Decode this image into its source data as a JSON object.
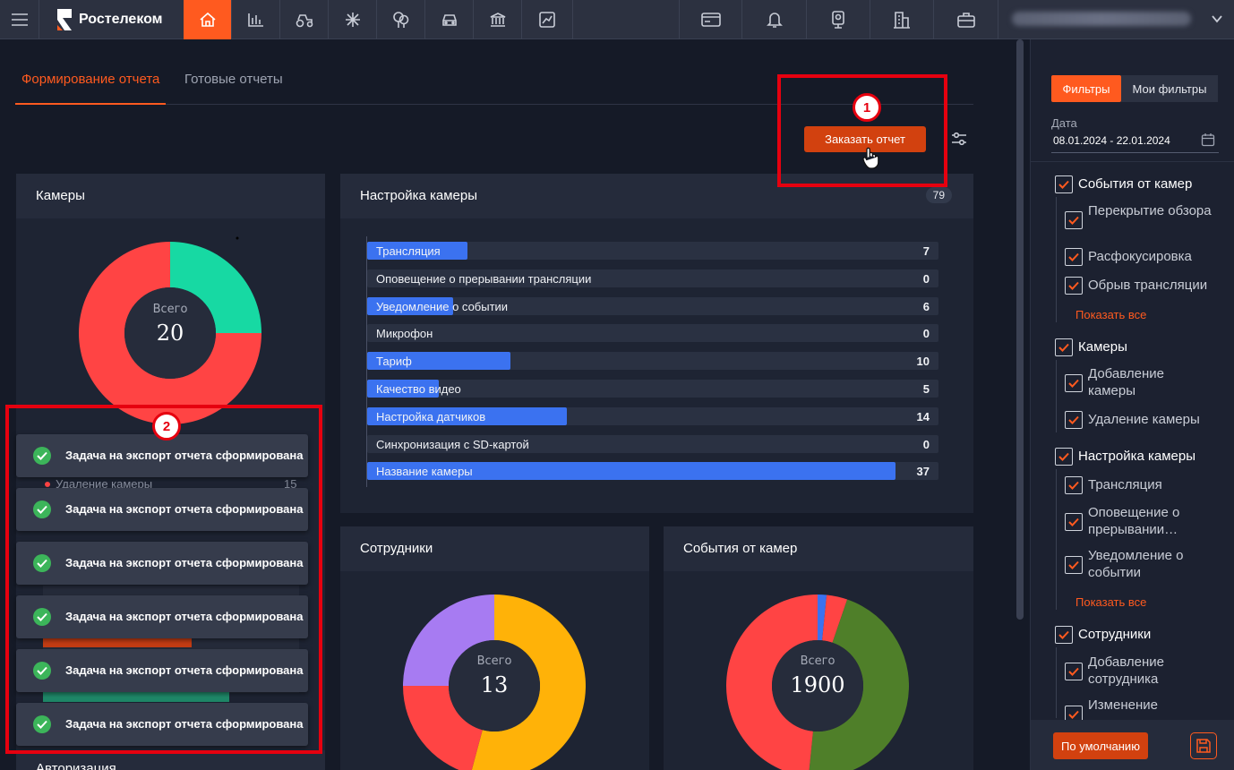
{
  "brand": {
    "name": "Ростелеком"
  },
  "user": {
    "email": ""
  },
  "tabs": [
    {
      "label": "Формирование отчета",
      "active": true
    },
    {
      "label": "Готовые отчеты",
      "active": false
    }
  ],
  "toolbar": {
    "order_report_label": "Заказать отчет"
  },
  "cameras_card": {
    "title": "Камеры",
    "total_label": "Всего",
    "total_value": "20",
    "legend_partial": "Удаление камеры",
    "legend_partial_value": "15",
    "bottom_title": "Авторизация"
  },
  "camera_settings_card": {
    "title": "Настройка камеры",
    "count": "79",
    "rows": [
      {
        "label": "Трансляция",
        "value": "7"
      },
      {
        "label": "Оповещение о прерывании трансляции",
        "value": "0"
      },
      {
        "label": "Уведомление о событии",
        "value": "6"
      },
      {
        "label": "Микрофон",
        "value": "0"
      },
      {
        "label": "Тариф",
        "value": "10"
      },
      {
        "label": "Качество видео",
        "value": "5"
      },
      {
        "label": "Настройка датчиков",
        "value": "14"
      },
      {
        "label": "Синхронизация с SD-картой",
        "value": "0"
      },
      {
        "label": "Название камеры",
        "value": "37"
      }
    ]
  },
  "employees_card": {
    "title": "Сотрудники",
    "total_label": "Всего",
    "total_value": "13"
  },
  "events_card": {
    "title": "События от камер",
    "total_label": "Всего",
    "total_value": "1900"
  },
  "notifications": [
    "Задача на экспорт отчета сформирована",
    "Задача на экспорт отчета сформирована",
    "Задача на экспорт отчета сформирована",
    "Задача на экспорт отчета сформирована",
    "Задача на экспорт отчета сформирована",
    "Задача на экспорт отчета сформирована"
  ],
  "markers": {
    "one": "1",
    "two": "2"
  },
  "filters": {
    "tab_filters": "Фильтры",
    "tab_my_filters": "Мои фильтры",
    "date_label": "Дата",
    "date_value": "08.01.2024 - 22.01.2024",
    "show_all": "Показать все",
    "groups": [
      {
        "label": "События от камер",
        "items": [
          "Перекрытие обзора",
          "Расфокусировка",
          "Обрыв трансляции"
        ]
      },
      {
        "label": "Камеры",
        "items": [
          "Добавление камеры",
          "Удаление камеры"
        ]
      },
      {
        "label": "Настройка камеры",
        "items": [
          "Трансляция",
          "Оповещение о прерывании…",
          "Уведомление о событии"
        ]
      },
      {
        "label": "Сотрудники",
        "items": [
          "Добавление сотрудника",
          "Изменение"
        ]
      }
    ],
    "default_label": "По умолчанию"
  },
  "colors": {
    "accent": "#ff5a1f",
    "bar": "#3b72f0",
    "green": "#17d9a3",
    "red": "#ff4444",
    "orange": "#ffb208",
    "purple": "#a77bf2",
    "olive": "#4f7f29"
  },
  "chart_data": [
    {
      "type": "pie",
      "title": "Камеры",
      "total": 20,
      "slices": [
        {
          "value": 5,
          "color": "#17d9a3"
        },
        {
          "value": 15,
          "color": "#ff4444"
        }
      ]
    },
    {
      "type": "bar",
      "title": "Настройка камеры",
      "categories": [
        "Трансляция",
        "Оповещение о прерывании трансляции",
        "Уведомление о событии",
        "Микрофон",
        "Тариф",
        "Качество видео",
        "Настройка датчиков",
        "Синхронизация с SD-картой",
        "Название камеры"
      ],
      "values": [
        7,
        0,
        6,
        0,
        10,
        5,
        14,
        0,
        37
      ],
      "xlim": [
        0,
        40
      ]
    },
    {
      "type": "pie",
      "title": "Сотрудники",
      "total": 13,
      "slices": [
        {
          "value": 6.5,
          "color": "#ffb208"
        },
        {
          "value": 2.5,
          "color": "#ff4444"
        },
        {
          "value": 3.0,
          "color": "#a77bf2"
        }
      ]
    },
    {
      "type": "pie",
      "title": "События от камер",
      "total": 1900,
      "slices": [
        {
          "value": 30,
          "color": "#3b72f0"
        },
        {
          "value": 70,
          "color": "#ff4444"
        },
        {
          "value": 880,
          "color": "#4f7f29"
        },
        {
          "value": 920,
          "color": "#ff4444"
        }
      ]
    }
  ]
}
